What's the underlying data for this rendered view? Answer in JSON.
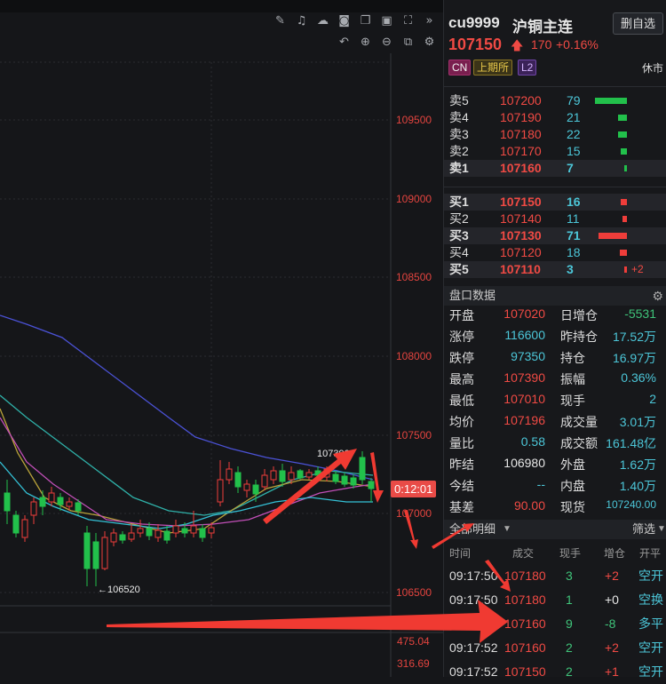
{
  "toolbar": {
    "row1": [
      "pencil-icon",
      "bell-icon",
      "cloud-icon",
      "camera-icon",
      "copy-icon",
      "image-icon",
      "fullscreen-icon",
      "expand-icon"
    ],
    "row2": [
      "undo-icon",
      "zoom-in-icon",
      "zoom-out-icon",
      "layers-icon",
      "gear-icon"
    ]
  },
  "axis": {
    "labels": [
      "109500",
      "109000",
      "108500",
      "108000",
      "107500",
      "107000",
      "106500"
    ],
    "current_time": "0:12:01",
    "vol_labels": [
      "475.04",
      "316.69"
    ]
  },
  "annotations": {
    "high": "107390",
    "low": "←106520"
  },
  "header": {
    "code": "cu9999",
    "name": "沪铜主连",
    "watch_button": "删自选",
    "price": "107150",
    "arrow": "🡅",
    "change": "170",
    "pct": "+0.16%",
    "tags": [
      "CN",
      "上期所",
      "L2"
    ],
    "status": "休市"
  },
  "orderbook": {
    "asks": [
      {
        "label": "卖5",
        "price": "107200",
        "vol": "79",
        "bar": 0.9
      },
      {
        "label": "卖4",
        "price": "107190",
        "vol": "21",
        "bar": 0.24
      },
      {
        "label": "卖3",
        "price": "107180",
        "vol": "22",
        "bar": 0.25
      },
      {
        "label": "卖2",
        "price": "107170",
        "vol": "15",
        "bar": 0.17
      },
      {
        "label": "卖1",
        "price": "107160",
        "vol": "7",
        "bar": 0.08
      }
    ],
    "bids": [
      {
        "label": "买1",
        "price": "107150",
        "vol": "16",
        "bar": 0.18
      },
      {
        "label": "买2",
        "price": "107140",
        "vol": "11",
        "bar": 0.12
      },
      {
        "label": "买3",
        "price": "107130",
        "vol": "71",
        "bar": 0.8
      },
      {
        "label": "买4",
        "price": "107120",
        "vol": "18",
        "bar": 0.2
      },
      {
        "label": "买5",
        "price": "107110",
        "vol": "3",
        "bar": 0.04,
        "extra": "+2"
      }
    ]
  },
  "stats_header": "盘口数据",
  "stats": [
    {
      "l": "开盘",
      "v": "107020",
      "vc": "#f04a44",
      "l2": "日增仓",
      "v2": "-5531",
      "v2c": "#3fc47a"
    },
    {
      "l": "涨停",
      "v": "116600",
      "vc": "#4cc6d8",
      "l2": "昨持仓",
      "v2": "17.52万",
      "v2c": "#4cc6d8"
    },
    {
      "l": "跌停",
      "v": "97350",
      "vc": "#4cc6d8",
      "l2": "持仓",
      "v2": "16.97万",
      "v2c": "#4cc6d8"
    },
    {
      "l": "最高",
      "v": "107390",
      "vc": "#f04a44",
      "l2": "振幅",
      "v2": "0.36%",
      "v2c": "#4cc6d8"
    },
    {
      "l": "最低",
      "v": "107010",
      "vc": "#f04a44",
      "l2": "现手",
      "v2": "2",
      "v2c": "#4cc6d8"
    },
    {
      "l": "均价",
      "v": "107196",
      "vc": "#f04a44",
      "l2": "成交量",
      "v2": "3.01万",
      "v2c": "#4cc6d8"
    },
    {
      "l": "量比",
      "v": "0.58",
      "vc": "#4cc6d8",
      "l2": "成交额",
      "v2": "161.48亿",
      "v2c": "#4cc6d8"
    },
    {
      "l": "昨结",
      "v": "106980",
      "vc": "#e6e6e6",
      "l2": "外盘",
      "v2": "1.62万",
      "v2c": "#4cc6d8"
    },
    {
      "l": "今结",
      "v": "--",
      "vc": "#4cc6d8",
      "l2": "内盘",
      "v2": "1.40万",
      "v2c": "#4cc6d8"
    },
    {
      "l": "基差",
      "v": "90.00",
      "vc": "#f04a44",
      "l2": "现货",
      "v2": "107240.00",
      "v2c": "#4cc6d8"
    }
  ],
  "trades_header": "全部明细",
  "filter_label": "筛选",
  "trades_cols": [
    "时间",
    "成交",
    "现手",
    "增仓",
    "开平"
  ],
  "trades": [
    {
      "t": "09:17:50",
      "p": "107180",
      "v": "3",
      "d": "+2",
      "dc": "#f04a44",
      "k": "空开",
      "kc": "#4cc6d8"
    },
    {
      "t": "09:17:50",
      "p": "107180",
      "v": "1",
      "d": "+0",
      "dc": "#e6e6e6",
      "k": "空换",
      "kc": "#4cc6d8"
    },
    {
      "t": "09:17:50",
      "p": "107160",
      "v": "9",
      "d": "-8",
      "dc": "#3fc47a",
      "k": "多平",
      "kc": "#4cc6d8"
    },
    {
      "t": "09:17:52",
      "p": "107160",
      "v": "2",
      "d": "+2",
      "dc": "#f04a44",
      "k": "空开",
      "kc": "#4cc6d8"
    },
    {
      "t": "09:17:52",
      "p": "107150",
      "v": "2",
      "d": "+1",
      "dc": "#f04a44",
      "k": "空开",
      "kc": "#4cc6d8"
    }
  ]
}
